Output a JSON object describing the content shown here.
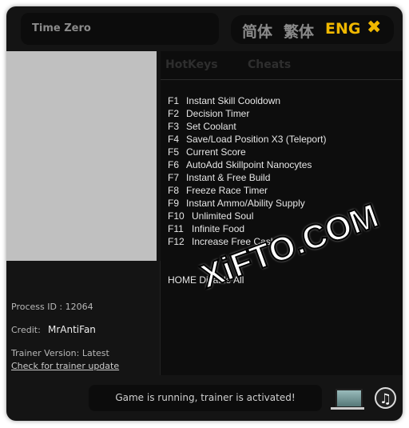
{
  "title": "Time Zero",
  "languages": [
    "简体",
    "繁体",
    "ENG"
  ],
  "accent": "#f0b800",
  "tabs": [
    "HotKeys",
    "Cheats"
  ],
  "hotkeys": [
    {
      "key": "F1",
      "label": "Instant Skill Cooldown"
    },
    {
      "key": "F2",
      "label": "Decision Timer"
    },
    {
      "key": "F3",
      "label": "Set Coolant"
    },
    {
      "key": "F4",
      "label": "Save/Load Position X3 (Teleport)"
    },
    {
      "key": "F5",
      "label": "Current Score"
    },
    {
      "key": "F6",
      "label": "AutoAdd Skillpoint Nanocytes"
    },
    {
      "key": "F7",
      "label": "Instant & Free Build"
    },
    {
      "key": "F8",
      "label": "Freeze Race Timer"
    },
    {
      "key": "F9",
      "label": "Instant Ammo/Ability Supply"
    },
    {
      "key": "F10",
      "label": "Unlimited Soul"
    },
    {
      "key": "F11",
      "label": "Infinite Food"
    },
    {
      "key": "F12",
      "label": "Increase Free Cash"
    }
  ],
  "disable_all": "HOME Disable All",
  "process_id": "Process ID : 12064",
  "credit_label": "Credit:",
  "credit_value": "MrAntiFan",
  "version": "Trainer Version: Latest",
  "update_link": "Check for trainer update",
  "status": "Game is running, trainer is activated!",
  "watermark": "XiFTO.COM"
}
